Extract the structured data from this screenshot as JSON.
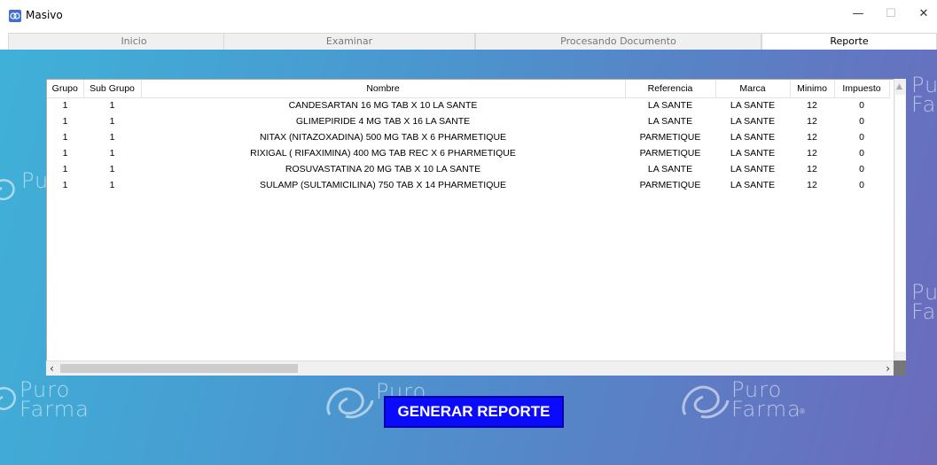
{
  "window": {
    "title": "Masivo",
    "minimize_glyph": "—",
    "maximize_glyph": "☐",
    "close_glyph": "✕"
  },
  "tabs": [
    {
      "label": "Inicio",
      "active": false
    },
    {
      "label": "Examinar",
      "active": false
    },
    {
      "label": "Procesando Documento",
      "active": false
    },
    {
      "label": "Reporte",
      "active": true
    }
  ],
  "watermark": {
    "line1": "Puro",
    "line2": "Farma",
    "reg": "®"
  },
  "table": {
    "columns": [
      "Grupo",
      "Sub Grupo",
      "Nombre",
      "Referencia",
      "Marca",
      "Minimo",
      "Impuesto"
    ],
    "rows": [
      [
        "1",
        "1",
        "CANDESARTAN 16 MG TAB X 10 LA SANTE",
        "LA SANTE",
        "LA SANTE",
        "12",
        "0"
      ],
      [
        "1",
        "1",
        "GLIMEPIRIDE 4 MG TAB X 16 LA SANTE",
        "LA SANTE",
        "LA SANTE",
        "12",
        "0"
      ],
      [
        "1",
        "1",
        "NITAX (NITAZOXADINA) 500 MG TAB X 6 PHARMETIQUE",
        "PARMETIQUE",
        "LA SANTE",
        "12",
        "0"
      ],
      [
        "1",
        "1",
        "RIXIGAL ( RIFAXIMINA) 400 MG TAB REC  X 6 PHARMETIQUE",
        "PARMETIQUE",
        "LA SANTE",
        "12",
        "0"
      ],
      [
        "1",
        "1",
        "ROSUVASTATINA 20 MG TAB  X 10 LA SANTE",
        "LA SANTE",
        "LA SANTE",
        "12",
        "0"
      ],
      [
        "1",
        "1",
        "SULAMP (SULTAMICILINA) 750 TAB X 14  PHARMETIQUE",
        "PARMETIQUE",
        "LA SANTE",
        "12",
        "0"
      ]
    ]
  },
  "button": {
    "generate": "GENERAR REPORTE"
  },
  "colors": {
    "button_bg": "#0a0aff",
    "gradient_start": "#3fb1d8",
    "gradient_end": "#6c6abc"
  }
}
